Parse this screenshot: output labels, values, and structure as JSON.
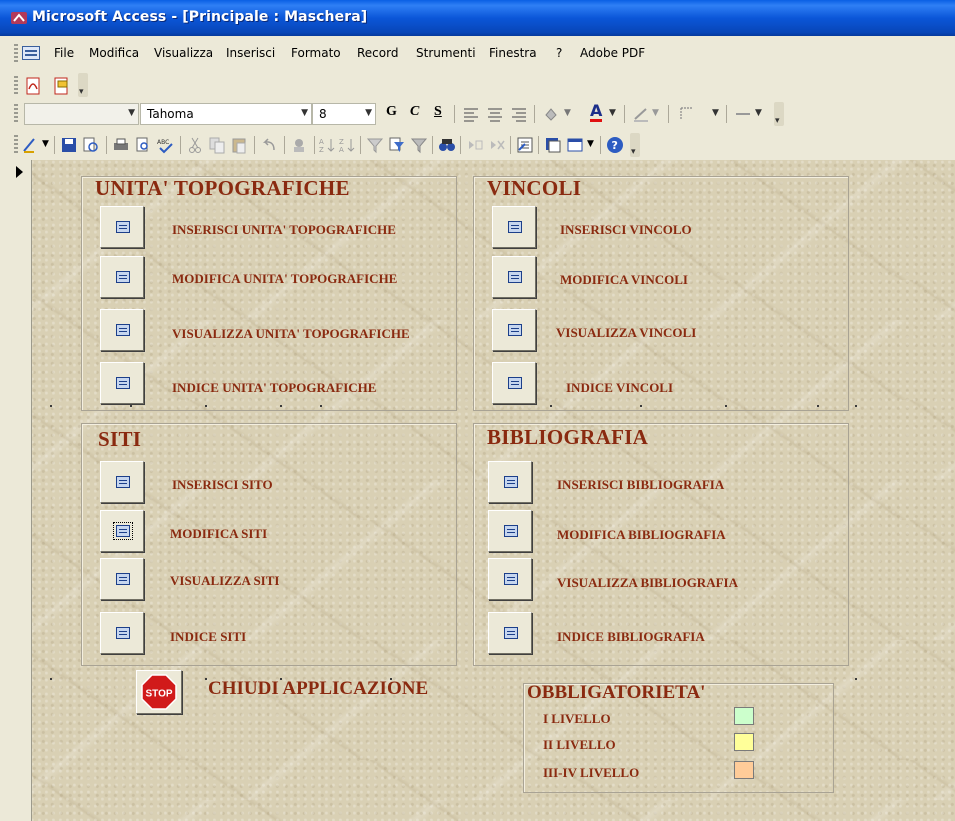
{
  "window": {
    "title": "Microsoft Access - [Principale : Maschera]"
  },
  "menu": [
    "File",
    "Modifica",
    "Visualizza",
    "Inserisci",
    "Formato",
    "Record",
    "Strumenti",
    "Finestra",
    "?",
    "Adobe PDF"
  ],
  "format_toolbar": {
    "font_name": "Tahoma",
    "font_size": "8",
    "bold": "G",
    "italic": "C",
    "underline": "S",
    "font_color_letter": "A"
  },
  "sections": {
    "unita": {
      "title": "UNITA' TOPOGRAFICHE",
      "buttons": [
        "INSERISCI UNITA' TOPOGRAFICHE",
        "MODIFICA UNITA' TOPOGRAFICHE",
        "VISUALIZZA UNITA' TOPOGRAFICHE",
        "INDICE UNITA' TOPOGRAFICHE"
      ]
    },
    "vincoli": {
      "title": "VINCOLI",
      "buttons": [
        "INSERISCI VINCOLO",
        "MODIFICA VINCOLI",
        "VISUALIZZA VINCOLI",
        "INDICE VINCOLI"
      ]
    },
    "siti": {
      "title": "SITI",
      "buttons": [
        "INSERISCI SITO",
        "MODIFICA SITI",
        "VISUALIZZA SITI",
        "INDICE SITI"
      ]
    },
    "bibliografia": {
      "title": "BIBLIOGRAFIA",
      "buttons": [
        "INSERISCI BIBLIOGRAFIA",
        "MODIFICA BIBLIOGRAFIA",
        "VISUALIZZA BIBLIOGRAFIA",
        "INDICE BIBLIOGRAFIA"
      ]
    }
  },
  "close": {
    "stop_text": "STOP",
    "label": "CHIUDI APPLICAZIONE"
  },
  "legend": {
    "title": "OBBLIGATORIETA'",
    "levels": [
      {
        "label": "I LIVELLO",
        "color": "#ccffcc"
      },
      {
        "label": "II LIVELLO",
        "color": "#ffff99"
      },
      {
        "label": "III-IV LIVELLO",
        "color": "#ffcc99"
      }
    ]
  },
  "colors": {
    "label_text": "#8a2a10",
    "titlebar": "#0b56d8"
  }
}
